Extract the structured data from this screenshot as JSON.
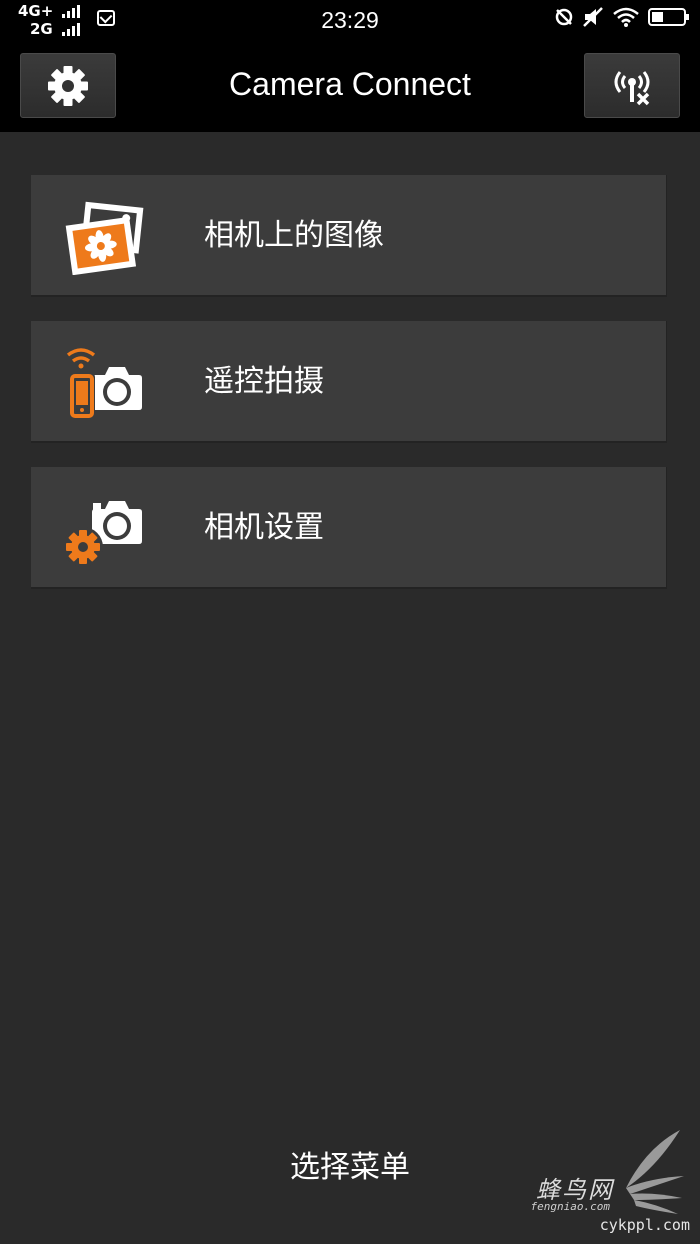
{
  "status_bar": {
    "network_top": "4G+",
    "network_bottom": "2G",
    "time": "23:29",
    "icons": [
      "signal-bars-icon",
      "mail-icon",
      "sync-off-icon",
      "mute-icon",
      "wifi-icon",
      "battery-icon"
    ]
  },
  "header": {
    "title": "Camera Connect",
    "settings_icon": "gear-icon",
    "connection_icon": "wireless-disconnect-icon"
  },
  "menu": {
    "items": [
      {
        "label": "相机上的图像",
        "icon": "camera-images-icon"
      },
      {
        "label": "遥控拍摄",
        "icon": "remote-shooting-icon"
      },
      {
        "label": "相机设置",
        "icon": "camera-settings-icon"
      }
    ]
  },
  "footer": {
    "label": "选择菜单"
  },
  "watermark": {
    "brand": "蜂鸟网",
    "sub": "fengniao.com",
    "url": "cykppl.com"
  },
  "colors": {
    "background": "#2a2a2a",
    "bar": "#000000",
    "item": "#3c3c3c",
    "accent": "#ee7a1b"
  }
}
